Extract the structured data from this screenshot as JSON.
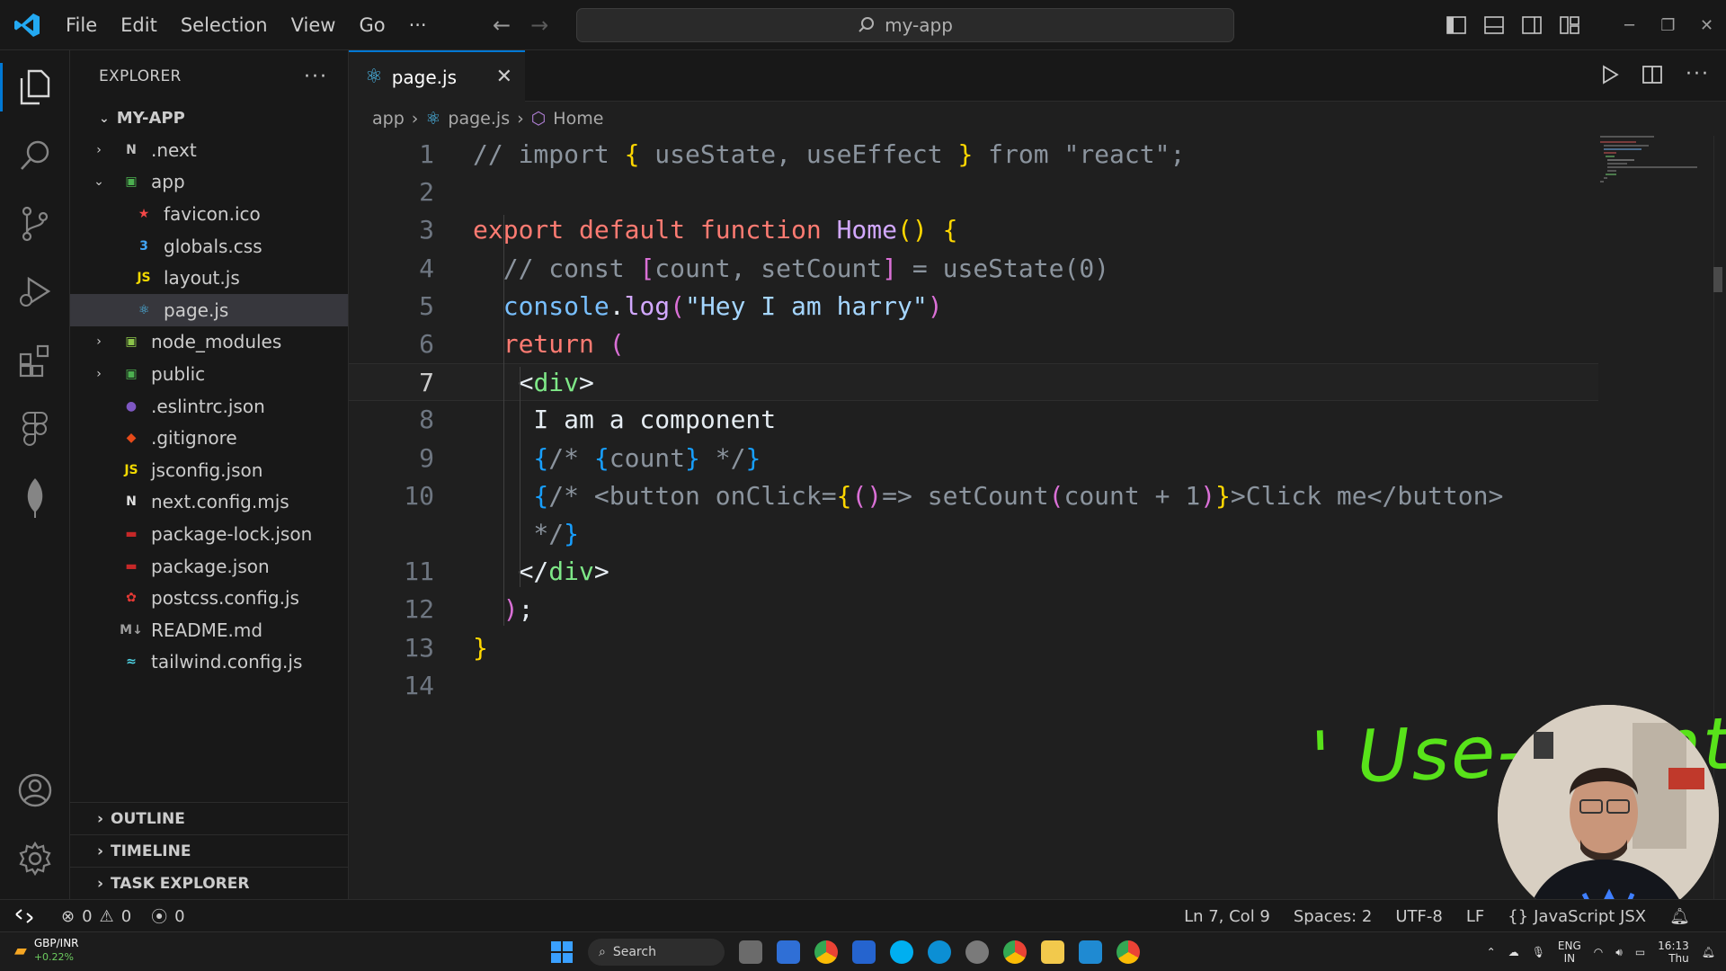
{
  "window": {
    "search_text": "my-app",
    "menu": [
      "File",
      "Edit",
      "Selection",
      "View",
      "Go",
      "···"
    ]
  },
  "activity": [
    "explorer-icon",
    "search-icon",
    "source-control-icon",
    "run-debug-icon",
    "extensions-icon",
    "figma-icon",
    "mongodb-leaf-icon",
    "account-icon",
    "manage-gear-icon"
  ],
  "sidebar": {
    "title": "EXPLORER",
    "more": "···",
    "root": "MY-APP",
    "items": [
      {
        "label": ".next",
        "icon": "N",
        "color": "#c0c0c0",
        "depth": 1,
        "chevron": "›"
      },
      {
        "label": "app",
        "icon": "▣",
        "color": "#4caf50",
        "depth": 1,
        "chevron": "⌄"
      },
      {
        "label": "favicon.ico",
        "icon": "★",
        "color": "#f44747",
        "depth": 2,
        "chevron": ""
      },
      {
        "label": "globals.css",
        "icon": "3",
        "color": "#42a5f5",
        "depth": 2,
        "chevron": ""
      },
      {
        "label": "layout.js",
        "icon": "JS",
        "color": "#f1d800",
        "depth": 2,
        "chevron": ""
      },
      {
        "label": "page.js",
        "icon": "⚛",
        "color": "#4fc3f7",
        "depth": 2,
        "chevron": ""
      },
      {
        "label": "node_modules",
        "icon": "▣",
        "color": "#8bc34a",
        "depth": 1,
        "chevron": "›"
      },
      {
        "label": "public",
        "icon": "▣",
        "color": "#4caf50",
        "depth": 1,
        "chevron": "›"
      },
      {
        "label": ".eslintrc.json",
        "icon": "●",
        "color": "#7e57c2",
        "depth": 1,
        "chevron": ""
      },
      {
        "label": ".gitignore",
        "icon": "◆",
        "color": "#e64a19",
        "depth": 1,
        "chevron": ""
      },
      {
        "label": "jsconfig.json",
        "icon": "JS",
        "color": "#f1d800",
        "depth": 1,
        "chevron": ""
      },
      {
        "label": "next.config.mjs",
        "icon": "N",
        "color": "#e0e0e0",
        "depth": 1,
        "chevron": ""
      },
      {
        "label": "package-lock.json",
        "icon": "▬",
        "color": "#c62828",
        "depth": 1,
        "chevron": ""
      },
      {
        "label": "package.json",
        "icon": "▬",
        "color": "#c62828",
        "depth": 1,
        "chevron": ""
      },
      {
        "label": "postcss.config.js",
        "icon": "✿",
        "color": "#e53935",
        "depth": 1,
        "chevron": ""
      },
      {
        "label": "README.md",
        "icon": "M↓",
        "color": "#9e9e9e",
        "depth": 1,
        "chevron": ""
      },
      {
        "label": "tailwind.config.js",
        "icon": "≈",
        "color": "#4dd0e1",
        "depth": 1,
        "chevron": ""
      }
    ],
    "sections": [
      "OUTLINE",
      "TIMELINE",
      "TASK EXPLORER"
    ]
  },
  "tab": {
    "label": "page.js",
    "close": "✕"
  },
  "breadcrumb": [
    "app",
    "page.js",
    "Home"
  ],
  "editor": {
    "current_line": 7,
    "line_numbers": [
      "1",
      "2",
      "3",
      "4",
      "5",
      "6",
      "7",
      "8",
      "9",
      "10",
      "",
      "11",
      "12",
      "13",
      "14"
    ],
    "lines": [
      [
        [
          "// import ",
          "c-com"
        ],
        [
          "{",
          "c-br1"
        ],
        [
          " useState, useEffect ",
          "c-com"
        ],
        [
          "}",
          "c-br1"
        ],
        [
          " from \"react\";",
          "c-com"
        ]
      ],
      [],
      [
        [
          "export default function ",
          "c-kw"
        ],
        [
          "Home",
          "c-fn"
        ],
        [
          "() ",
          "c-br1"
        ],
        [
          "{",
          "c-br1"
        ]
      ],
      [
        [
          "  // const ",
          "c-com"
        ],
        [
          "[",
          "c-br2"
        ],
        [
          "count, setCount",
          "c-com"
        ],
        [
          "]",
          "c-br2"
        ],
        [
          " = useState(0)",
          "c-com"
        ]
      ],
      [
        [
          "  console",
          "c-blu"
        ],
        [
          ".",
          "c-pun"
        ],
        [
          "log",
          "c-fn"
        ],
        [
          "(",
          "c-br2"
        ],
        [
          "\"Hey I am harry\"",
          "c-str"
        ],
        [
          ")",
          "c-br2"
        ]
      ],
      [
        [
          "  return ",
          "c-kw"
        ],
        [
          "(",
          "c-br2"
        ]
      ],
      [
        [
          "   <",
          "c-pun"
        ],
        [
          "div",
          "c-tag"
        ],
        [
          ">",
          "c-pun"
        ]
      ],
      [
        [
          "    I am a component",
          "c-txt"
        ]
      ],
      [
        [
          "    {",
          "c-br3"
        ],
        [
          "/* ",
          "c-com"
        ],
        [
          "{",
          "c-br3"
        ],
        [
          "count",
          "c-com"
        ],
        [
          "}",
          "c-br3"
        ],
        [
          " */",
          "c-com"
        ],
        [
          "}",
          "c-br3"
        ]
      ],
      [
        [
          "    {",
          "c-br3"
        ],
        [
          "/* <button onClick=",
          "c-com"
        ],
        [
          "{",
          "c-br1"
        ],
        [
          "()",
          "c-br2"
        ],
        [
          "=> setCount",
          "c-com"
        ],
        [
          "(",
          "c-br2"
        ],
        [
          "count + 1",
          "c-com"
        ],
        [
          ")",
          "c-br2"
        ],
        [
          "}",
          "c-br1"
        ],
        [
          ">Click me</button>",
          "c-com"
        ]
      ],
      [
        [
          "    */",
          "c-com"
        ],
        [
          "}",
          "c-br3"
        ]
      ],
      [
        [
          "   </",
          "c-pun"
        ],
        [
          "div",
          "c-tag"
        ],
        [
          ">",
          "c-pun"
        ]
      ],
      [
        [
          "  )",
          "c-br2"
        ],
        [
          ";",
          "c-pun"
        ]
      ],
      [
        [
          "}",
          "c-br1"
        ]
      ],
      []
    ],
    "annotation": "' Use-client ' removed"
  },
  "status": {
    "errors": "0",
    "warnings": "0",
    "ports": "0",
    "position": "Ln 7, Col 9",
    "spaces": "Spaces: 2",
    "encoding": "UTF-8",
    "eol": "LF",
    "language_prefix": "{}",
    "language": "JavaScript JSX"
  },
  "taskbar": {
    "ticker_pair": "GBP/INR",
    "ticker_change": "+0.22%",
    "search": "Search",
    "lang_top": "ENG",
    "lang_bottom": "IN",
    "time": "16:13",
    "day": "Thu"
  }
}
